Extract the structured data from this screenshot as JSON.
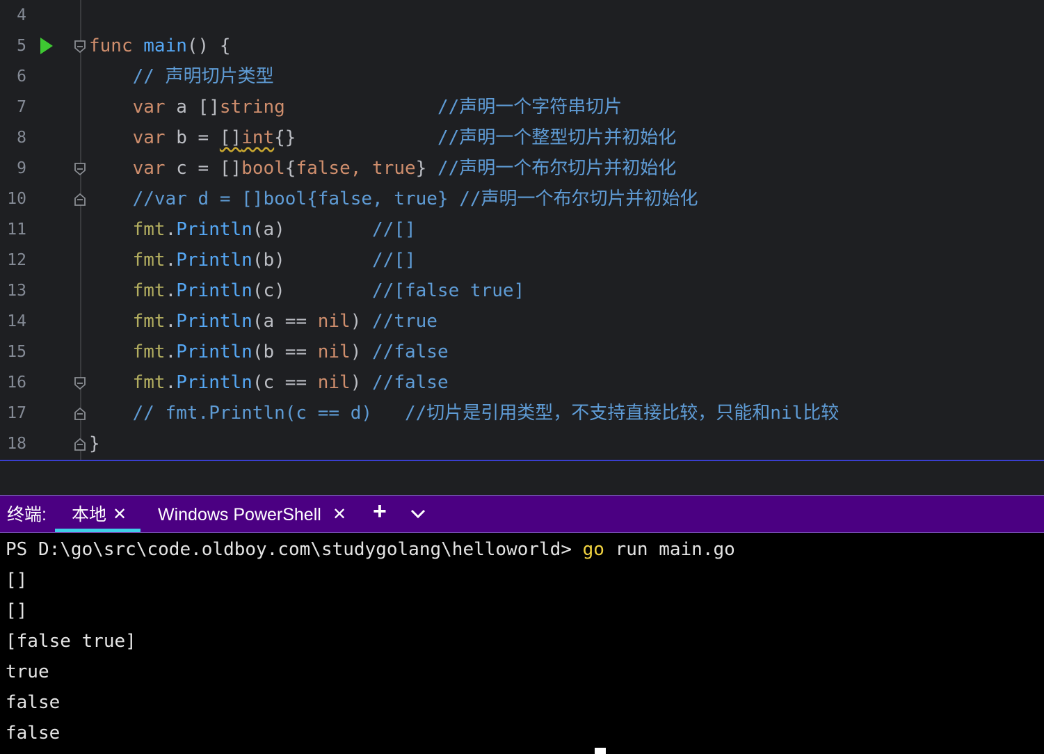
{
  "editor": {
    "lines": [
      {
        "num": "4",
        "tokens": []
      },
      {
        "num": "5",
        "run": true,
        "fold": "open",
        "tokens": [
          {
            "c": "kw",
            "t": "func"
          },
          {
            "c": "plain",
            "t": " "
          },
          {
            "c": "fn",
            "t": "main"
          },
          {
            "c": "plain",
            "t": "() {"
          }
        ]
      },
      {
        "num": "6",
        "tokens": [
          {
            "c": "plain",
            "t": "    "
          },
          {
            "c": "cm",
            "t": "// 声明切片类型"
          }
        ]
      },
      {
        "num": "7",
        "tokens": [
          {
            "c": "plain",
            "t": "    "
          },
          {
            "c": "kw",
            "t": "var"
          },
          {
            "c": "plain",
            "t": " a []"
          },
          {
            "c": "kw",
            "t": "string"
          },
          {
            "c": "plain",
            "t": "              "
          },
          {
            "c": "cm",
            "t": "//声明一个字符串切片"
          }
        ]
      },
      {
        "num": "8",
        "tokens": [
          {
            "c": "plain",
            "t": "    "
          },
          {
            "c": "kw",
            "t": "var"
          },
          {
            "c": "plain",
            "t": " b = "
          },
          {
            "c": "plain warn",
            "t": "[]"
          },
          {
            "c": "kw warn",
            "t": "int"
          },
          {
            "c": "plain",
            "t": "{}"
          },
          {
            "c": "plain",
            "t": "             "
          },
          {
            "c": "cm",
            "t": "//声明一个整型切片并初始化"
          }
        ]
      },
      {
        "num": "9",
        "fold": "open",
        "tokens": [
          {
            "c": "plain",
            "t": "    "
          },
          {
            "c": "kw",
            "t": "var"
          },
          {
            "c": "plain",
            "t": " c = []"
          },
          {
            "c": "kw",
            "t": "bool"
          },
          {
            "c": "plain",
            "t": "{"
          },
          {
            "c": "kw",
            "t": "false"
          },
          {
            "c": "kw",
            "t": ", "
          },
          {
            "c": "kw",
            "t": "true"
          },
          {
            "c": "plain",
            "t": "} "
          },
          {
            "c": "cm",
            "t": "//声明一个布尔切片并初始化"
          }
        ]
      },
      {
        "num": "10",
        "fold": "close",
        "tokens": [
          {
            "c": "plain",
            "t": "    "
          },
          {
            "c": "cm",
            "t": "//var d = []bool{false, true} //声明一个布尔切片并初始化"
          }
        ]
      },
      {
        "num": "11",
        "tokens": [
          {
            "c": "plain",
            "t": "    "
          },
          {
            "c": "pkg",
            "t": "fmt"
          },
          {
            "c": "plain",
            "t": "."
          },
          {
            "c": "fn",
            "t": "Println"
          },
          {
            "c": "plain",
            "t": "(a)        "
          },
          {
            "c": "cm",
            "t": "//[]"
          }
        ]
      },
      {
        "num": "12",
        "tokens": [
          {
            "c": "plain",
            "t": "    "
          },
          {
            "c": "pkg",
            "t": "fmt"
          },
          {
            "c": "plain",
            "t": "."
          },
          {
            "c": "fn",
            "t": "Println"
          },
          {
            "c": "plain",
            "t": "(b)        "
          },
          {
            "c": "cm",
            "t": "//[]"
          }
        ]
      },
      {
        "num": "13",
        "tokens": [
          {
            "c": "plain",
            "t": "    "
          },
          {
            "c": "pkg",
            "t": "fmt"
          },
          {
            "c": "plain",
            "t": "."
          },
          {
            "c": "fn",
            "t": "Println"
          },
          {
            "c": "plain",
            "t": "(c)        "
          },
          {
            "c": "cm",
            "t": "//[false true]"
          }
        ]
      },
      {
        "num": "14",
        "tokens": [
          {
            "c": "plain",
            "t": "    "
          },
          {
            "c": "pkg",
            "t": "fmt"
          },
          {
            "c": "plain",
            "t": "."
          },
          {
            "c": "fn",
            "t": "Println"
          },
          {
            "c": "plain",
            "t": "(a == "
          },
          {
            "c": "kw",
            "t": "nil"
          },
          {
            "c": "plain",
            "t": ") "
          },
          {
            "c": "cm",
            "t": "//true"
          }
        ]
      },
      {
        "num": "15",
        "tokens": [
          {
            "c": "plain",
            "t": "    "
          },
          {
            "c": "pkg",
            "t": "fmt"
          },
          {
            "c": "plain",
            "t": "."
          },
          {
            "c": "fn",
            "t": "Println"
          },
          {
            "c": "plain",
            "t": "(b == "
          },
          {
            "c": "kw",
            "t": "nil"
          },
          {
            "c": "plain",
            "t": ") "
          },
          {
            "c": "cm",
            "t": "//false"
          }
        ]
      },
      {
        "num": "16",
        "fold": "open",
        "tokens": [
          {
            "c": "plain",
            "t": "    "
          },
          {
            "c": "pkg",
            "t": "fmt"
          },
          {
            "c": "plain",
            "t": "."
          },
          {
            "c": "fn",
            "t": "Println"
          },
          {
            "c": "plain",
            "t": "(c == "
          },
          {
            "c": "kw",
            "t": "nil"
          },
          {
            "c": "plain",
            "t": ") "
          },
          {
            "c": "cm",
            "t": "//false"
          }
        ]
      },
      {
        "num": "17",
        "fold": "close",
        "tokens": [
          {
            "c": "plain",
            "t": "    "
          },
          {
            "c": "cm",
            "t": "// fmt.Println(c == d)   //切片是引用类型，不支持直接比较，只能和nil比较"
          }
        ]
      },
      {
        "num": "18",
        "fold": "close",
        "tokens": [
          {
            "c": "plain",
            "t": "}"
          }
        ]
      }
    ]
  },
  "terminal_tabs": {
    "prefix": "终端:",
    "local_tab": "本地",
    "powershell_tab": "Windows PowerShell",
    "close_glyph": "✕",
    "add_glyph": "+",
    "dropdown_glyph": "⌄"
  },
  "terminal": {
    "prompt": "PS D:\\go\\src\\code.oldboy.com\\studygolang\\helloworld> ",
    "command_go": "go",
    "command_rest": " run main.go",
    "output": [
      "[]",
      "[]",
      "[false true]",
      "true",
      "false",
      "false"
    ]
  },
  "colors": {
    "editor_bg": "#1e1f22",
    "keyword": "#cf8e6d",
    "function": "#56a8f5",
    "package": "#b3ae60",
    "comment": "#5f9cd6",
    "tab_bar": "#4b0082",
    "tab_active_underline": "#3fd0e8",
    "run_icon": "#3ec832"
  }
}
